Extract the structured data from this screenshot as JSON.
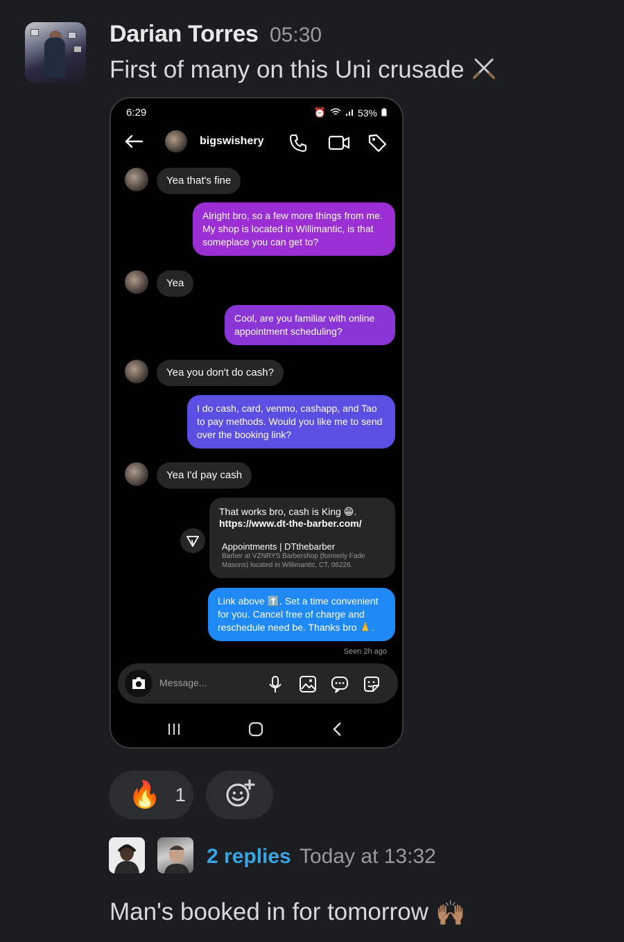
{
  "message": {
    "author": "Darian Torres",
    "time": "05:30",
    "text": "First of many on this Uni crusade",
    "emoji_icon": "crossed-swords-icon"
  },
  "screenshot": {
    "status_time": "6:29",
    "battery": "53%",
    "chat_name": "bigswishery",
    "messages": [
      {
        "from": "them",
        "text": "Yea that's fine"
      },
      {
        "from": "me",
        "text": "Alright bro, so a few more things from me. My shop is located in Willimantic, is that someplace you can get to?",
        "color": "#9b2fd3"
      },
      {
        "from": "them",
        "text": "Yea"
      },
      {
        "from": "me",
        "text": "Cool, are you familiar with online appointment scheduling?",
        "color": "#8a36d6"
      },
      {
        "from": "them",
        "text": "Yea you don't do cash?"
      },
      {
        "from": "me",
        "text": "I do cash, card, venmo, cashapp, and Tao to pay methods. Would you like me to send over the booking link?",
        "color": "#5b4ee3"
      },
      {
        "from": "them",
        "text": "Yea I'd pay cash"
      }
    ],
    "link_card": {
      "line1": "That works bro, cash is King 😁.",
      "url": "https://www.dt-the-barber.com/",
      "title": "Appointments | DTthebarber",
      "desc": "Barber at VZNRYS Barbershop (formerly Fade Masons) located in Willimantic, CT, 06226."
    },
    "last_message": {
      "text": "Link above ⬆️. Set a time convenient for you. Cancel free of charge and reschedule need be. Thanks bro 🙏.",
      "color": "#1f8af5"
    },
    "seen": "Seen 2h ago",
    "composer_placeholder": "Message..."
  },
  "reactions": [
    {
      "emoji": "🔥",
      "count": "1"
    },
    {
      "icon": "add-reaction-icon"
    }
  ],
  "thread": {
    "replies": "2 replies",
    "time": "Today at 13:32"
  },
  "message2": {
    "text": "Man's booked in for tomorrow",
    "emoji": "🙌🏽"
  },
  "colors": {
    "background": "#1c1d21",
    "link": "#3aa3e3",
    "reaction_bg": "#2c2d31"
  }
}
